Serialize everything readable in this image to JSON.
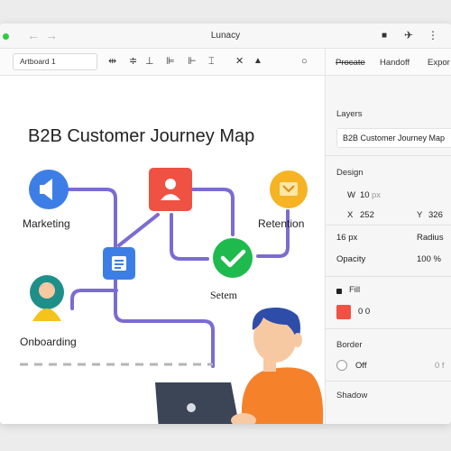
{
  "window": {
    "title": "Lunacy",
    "back_arrow": "←",
    "forward_arrow": "→"
  },
  "toolbar": {
    "artboard_label": "Artboard 1",
    "tools": [
      {
        "name": "align-distribute-icon",
        "glyph": "⇹"
      },
      {
        "name": "align-middle-icon",
        "glyph": "≑"
      },
      {
        "name": "align-bottom-icon",
        "glyph": "⊥"
      },
      {
        "name": "align-left-icon",
        "glyph": "⊫"
      },
      {
        "name": "align-right-icon",
        "glyph": "⊩"
      },
      {
        "name": "align-center-icon",
        "glyph": "⌶"
      },
      {
        "name": "cross-icon",
        "glyph": "✕"
      },
      {
        "name": "pointer-icon",
        "glyph": "▲"
      },
      {
        "name": "circle-tool-icon",
        "glyph": "○"
      }
    ]
  },
  "titlebar_icons": {
    "stop": "■",
    "pin": "✈",
    "more": "⋮"
  },
  "inspector_tabs": [
    "Procate",
    "Handoff",
    "Expor"
  ],
  "canvas": {
    "title": "B2B Customer Journey Map",
    "nodes": {
      "marketing": "Marketing",
      "retention": "Retention",
      "setem": "Setem",
      "onboarding": "Onboarding"
    },
    "colors": {
      "path": "#7b6cd1",
      "marketing": "#3d7ee6",
      "profile": "#ef5143",
      "retention": "#f6b324",
      "checkmark": "#1fba4e",
      "document": "#3d7ee6",
      "onboarding_head": "#1f8f8a",
      "onboarding_body": "#f6c31d",
      "dashed": "#b5b5b5",
      "shirt": "#f5822a",
      "hair": "#2d4da8",
      "skin": "#f7c9a3",
      "laptop": "#3b4556"
    }
  },
  "inspector": {
    "layers_title": "Layers",
    "layer_name": "B2B Customer Journey Map",
    "design_title": "Design",
    "w_label": "W",
    "w_value": "10",
    "w_unit": "px",
    "x_label": "X",
    "x_value": "252",
    "y_label": "Y",
    "y_value": "326",
    "font_size": "16 px",
    "radius_label": "Radius",
    "opacity_label": "Opacity",
    "opacity_value": "100 %",
    "fill_title": "Fill",
    "fill_value": "0 0",
    "fill_color": "#ef5143",
    "border_title": "Border",
    "border_value": "Off",
    "border_extra": "0 f",
    "shadow_title": "Shadow"
  }
}
